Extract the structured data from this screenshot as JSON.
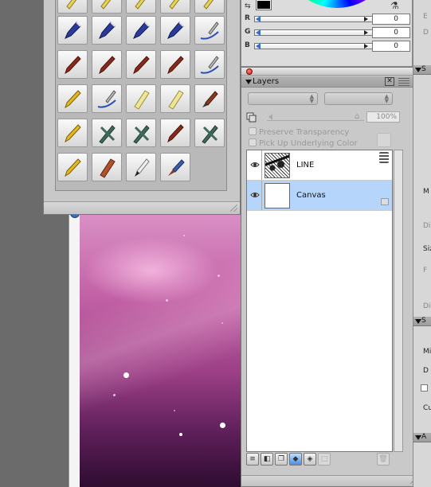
{
  "color_panel": {
    "rows": [
      {
        "label": "R",
        "value": "0"
      },
      {
        "label": "G",
        "value": "0"
      },
      {
        "label": "B",
        "value": "0"
      }
    ]
  },
  "layers_panel": {
    "title": "Layers",
    "opacity": "100%",
    "preserve_transparency_label": "Preserve Transparency",
    "pick_up_underlying_color_label": "Pick Up Underlying Color",
    "layers": [
      {
        "name": "LINE",
        "selected": false
      },
      {
        "name": "Canvas",
        "selected": true
      }
    ]
  },
  "right_panel": {
    "labels": [
      "E",
      "D",
      "S",
      "M",
      "Di",
      "Siz",
      "F",
      "Di",
      "S",
      "Min",
      "D",
      "Cub",
      "A"
    ]
  }
}
